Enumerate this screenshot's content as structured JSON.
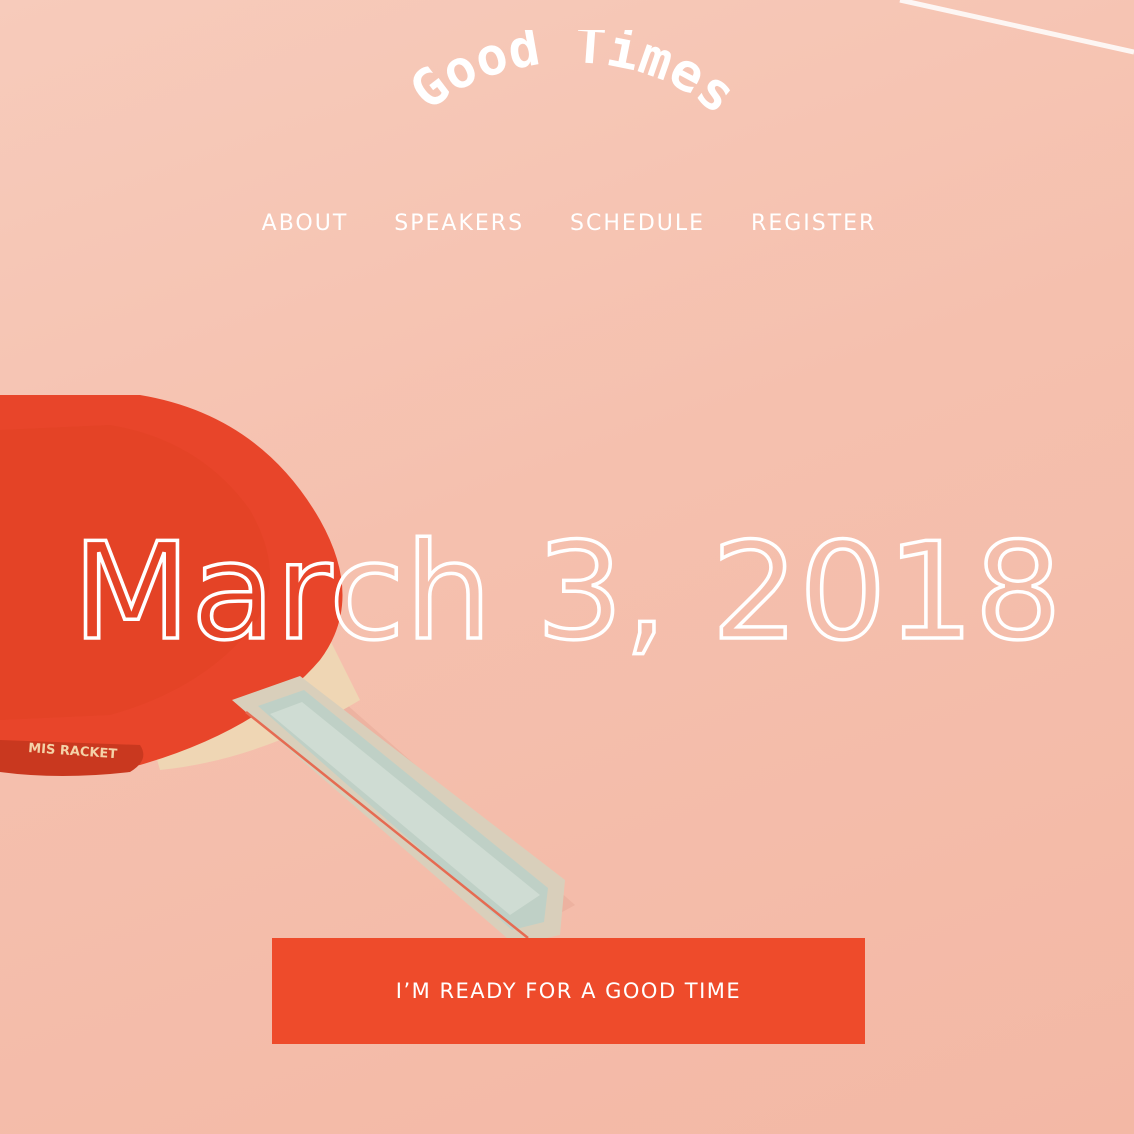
{
  "brand": {
    "logo_text": "Good Times"
  },
  "nav": {
    "items": [
      {
        "label": "ABOUT"
      },
      {
        "label": "SPEAKERS"
      },
      {
        "label": "SCHEDULE"
      },
      {
        "label": "REGISTER"
      }
    ]
  },
  "hero": {
    "date": "March 3, 2018",
    "paddle_text": "MIS RACKET",
    "cta_label": "I’M READY FOR A GOOD TIME"
  },
  "colors": {
    "background": "#f6c3b1",
    "accent": "#ee4b2b",
    "paddle_red": "#e8452a"
  }
}
